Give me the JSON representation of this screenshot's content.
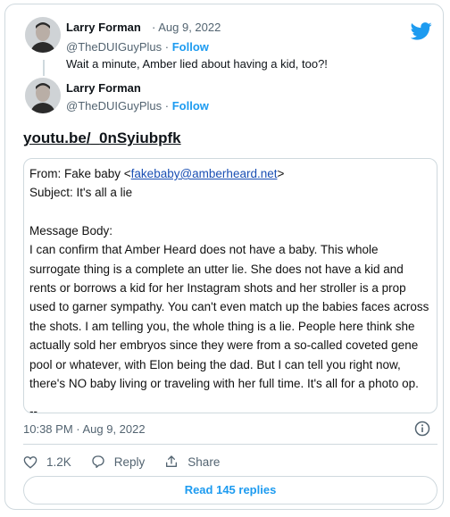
{
  "tweet1": {
    "name": "Larry Forman",
    "date": "· Aug 9, 2022",
    "handle": "@TheDUIGuyPlus",
    "dot": "·",
    "follow": "Follow",
    "text": "Wait a minute, Amber lied about having a kid, too?!"
  },
  "tweet2": {
    "name": "Larry Forman",
    "handle": "@TheDUIGuyPlus",
    "dot": "·",
    "follow": "Follow",
    "link": "youtu.be/_0nSyiubpfk"
  },
  "email": {
    "from_label": "From: Fake baby <",
    "from_address": "fakebaby@amberheard.net",
    "from_end": ">",
    "subject": "Subject: It's all a lie",
    "body_label": "Message Body:",
    "body": "I can confirm that Amber Heard does not have a baby. This whole surrogate thing is a complete an utter lie. She does not have a kid and rents or borrows a kid for her Instagram shots and her stroller is a prop used to garner sympathy. You can't even match up the babies faces across the shots. I am telling you, the whole thing is a lie. People here think she actually sold her embryos since they were from a so-called coveted gene pool or whatever, with Elon being the dad. But I can tell you right now, there's NO baby living or traveling with her full time. It's all for a photo op.",
    "sig": "--"
  },
  "timestamp": "10:38 PM · Aug 9, 2022",
  "actions": {
    "likes": "1.2K",
    "reply": "Reply",
    "share": "Share"
  },
  "read_replies": "Read 145 replies",
  "colors": {
    "accent": "#1d9bf0",
    "muted": "#536471",
    "border": "#cfd9de"
  },
  "icons": [
    "twitter-bird-icon",
    "info-icon",
    "heart-icon",
    "reply-icon",
    "share-icon"
  ]
}
